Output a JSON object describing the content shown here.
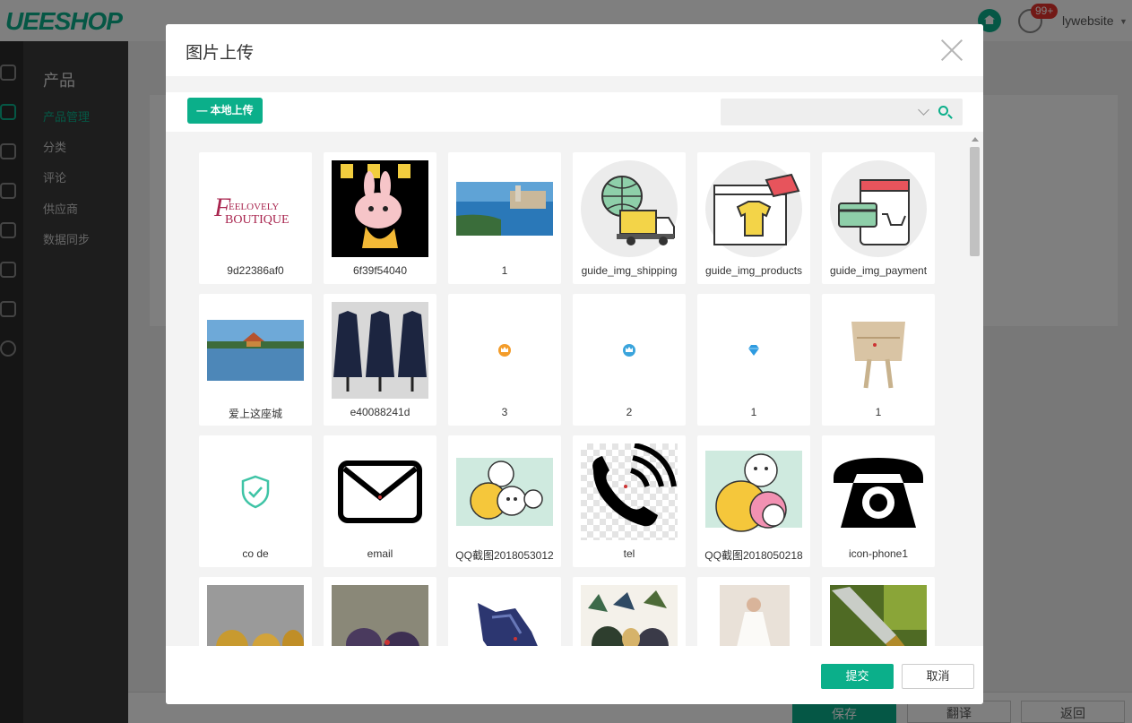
{
  "app": {
    "logo": "UEESHOP",
    "notification_badge": "99+",
    "user_name": "lywebsite"
  },
  "sidebar": {
    "title": "产品",
    "items": [
      {
        "label": "产品管理",
        "active": true
      },
      {
        "label": "分类"
      },
      {
        "label": "评论"
      },
      {
        "label": "供应商"
      },
      {
        "label": "数据同步"
      }
    ]
  },
  "page_actions": {
    "save": "保存",
    "translate": "翻译",
    "back": "返回"
  },
  "modal": {
    "title": "图片上传",
    "upload_button": "本地上传",
    "search": {
      "value": "",
      "placeholder": ""
    },
    "submit": "提交",
    "cancel": "取消",
    "images": [
      {
        "label": "9d22386af0",
        "icon": "feelovely-boutique-logo"
      },
      {
        "label": "6f39f54040",
        "icon": "cartoon-rabbit-sticker"
      },
      {
        "label": "1",
        "icon": "harbour-city-photo"
      },
      {
        "label": "guide_img_shipping",
        "icon": "shipping-truck-globe"
      },
      {
        "label": "guide_img_products",
        "icon": "products-tshirt-tag"
      },
      {
        "label": "guide_img_payment",
        "icon": "payment-card-shop"
      },
      {
        "label": "爱上这座城",
        "icon": "palace-lake-photo"
      },
      {
        "label": "e40088241d",
        "icon": "navy-dresses-photo"
      },
      {
        "label": "3",
        "icon": "gold-crown-badge"
      },
      {
        "label": "2",
        "icon": "blue-crown-badge"
      },
      {
        "label": "1",
        "icon": "diamond-badge"
      },
      {
        "label": "1",
        "icon": "beige-belt-photo"
      },
      {
        "label": "co de",
        "icon": "shield-check-icon"
      },
      {
        "label": "email",
        "icon": "envelope-icon"
      },
      {
        "label": "QQ截图2018053012",
        "icon": "cartoon-cats-sticker"
      },
      {
        "label": "tel",
        "icon": "phone-ringing-icon"
      },
      {
        "label": "QQ截图2018050218",
        "icon": "cartoon-cat-sticker"
      },
      {
        "label": "icon-phone1",
        "icon": "rotary-phone-icon"
      },
      {
        "label": "",
        "icon": "gold-dragon-figurines"
      },
      {
        "label": "",
        "icon": "purple-dragon-figurines"
      },
      {
        "label": "",
        "icon": "blue-dragon-figurine"
      },
      {
        "label": "",
        "icon": "crystal-figurines"
      },
      {
        "label": "",
        "icon": "wedding-dress-photo"
      },
      {
        "label": "",
        "icon": "ornate-knife-photo"
      }
    ]
  },
  "colors": {
    "accent": "#0baf8a",
    "badge": "#e5322d"
  }
}
